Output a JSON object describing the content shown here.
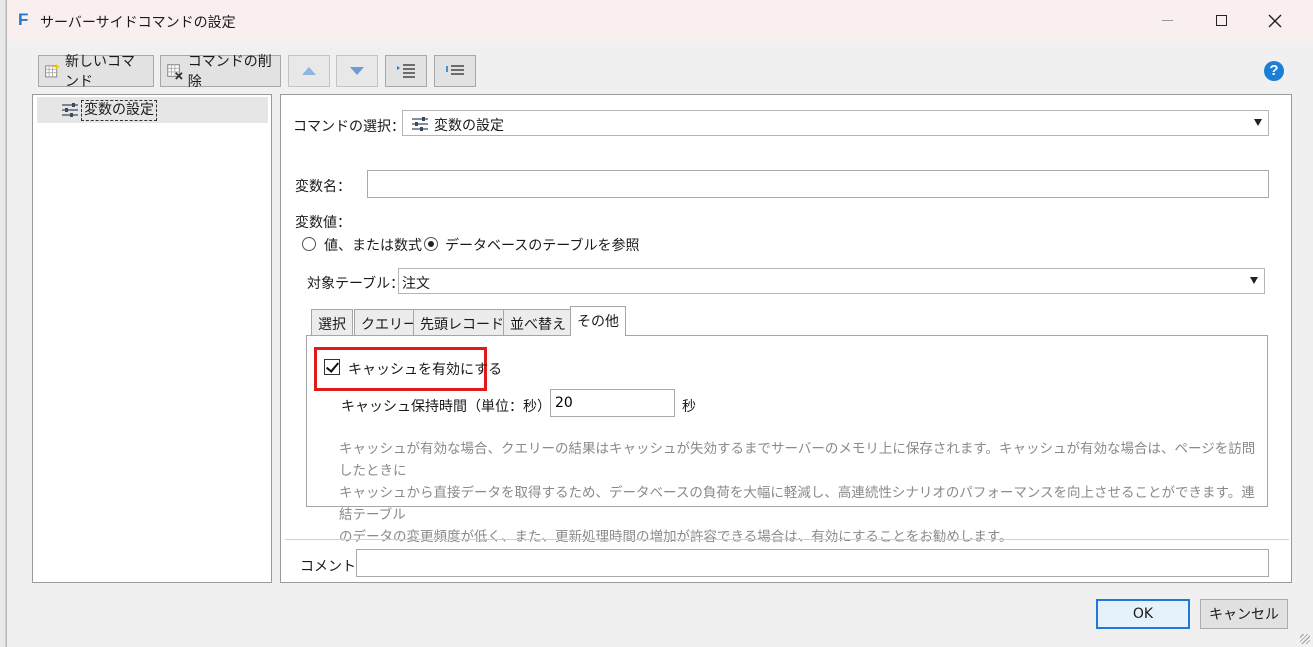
{
  "window": {
    "title": "サーバーサイドコマンドの設定",
    "app_icon_letter": "F"
  },
  "toolbar": {
    "new_command": "新しいコマンド",
    "delete_command": "コマンドの削除"
  },
  "tree": {
    "items": [
      {
        "label": "変数の設定",
        "icon": "sliders-icon",
        "selected": true
      }
    ]
  },
  "command": {
    "select_label": "コマンドの選択：",
    "selected_value": "変数の設定"
  },
  "variable": {
    "name_label": "変数名：",
    "name_value": "",
    "value_label": "変数値：",
    "radio_formula": "値、または数式",
    "radio_database": "データベースのテーブルを参照",
    "selected_radio": "database",
    "target_table_label": "対象テーブル：",
    "target_table_value": "注文"
  },
  "tabs": [
    {
      "label": "選択",
      "active": false
    },
    {
      "label": "クエリー",
      "active": false
    },
    {
      "label": "先頭レコード",
      "active": false
    },
    {
      "label": "並べ替え",
      "active": false
    },
    {
      "label": "その他",
      "active": true
    }
  ],
  "other_tab": {
    "cache_checkbox_label": "キャッシュを有効にする",
    "cache_enabled": true,
    "cache_time_label": "キャッシュ保持時間（単位：秒）",
    "cache_time_value": "20",
    "cache_time_unit": "秒",
    "description_lines": [
      "キャッシュが有効な場合、クエリーの結果はキャッシュが失効するまでサーバーのメモリ上に保存されます。キャッシュが有効な場合は、ページを訪問したときに",
      "キャッシュから直接データを取得するため、データベースの負荷を大幅に軽減し、高連続性シナリオのパフォーマンスを向上させることができます。連結テーブル",
      "のデータの変更頻度が低く、また、更新処理時間の増加が許容できる場合は、有効にすることをお勧めします。"
    ]
  },
  "comment": {
    "label": "コメント",
    "value": ""
  },
  "buttons": {
    "ok": "OK",
    "cancel": "キャンセル"
  },
  "colors": {
    "highlight_border": "#e01b1b",
    "help_icon": "#1c7fd6",
    "ok_border": "#1d7ad8"
  }
}
